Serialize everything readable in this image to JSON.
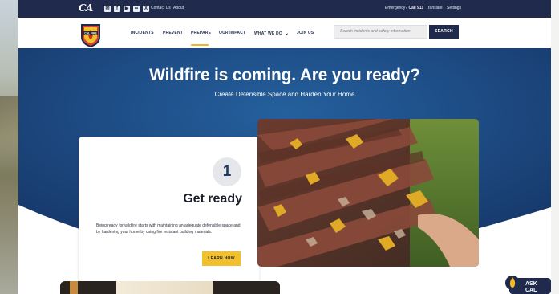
{
  "colors": {
    "navy": "#1f2a4c",
    "hero_blue": "#1e4f85",
    "accent_yellow": "#f2c02b",
    "active_underline": "#f2b824"
  },
  "utility_bar": {
    "logo": "CA",
    "social_icons": [
      "email-icon",
      "facebook-icon",
      "youtube-icon",
      "flickr-icon",
      "x-icon"
    ],
    "links": [
      "Contact Us",
      "About"
    ],
    "emergency_prefix": "Emergency?",
    "emergency_call": "Call 911",
    "translate": "Translate",
    "settings": "Settings"
  },
  "nav": {
    "logo_text": "CAL FIRE",
    "items": [
      {
        "label": "INCIDENTS"
      },
      {
        "label": "PREVENT"
      },
      {
        "label": "PREPARE",
        "active": true
      },
      {
        "label": "OUR IMPACT"
      },
      {
        "label": "WHAT WE DO"
      },
      {
        "label": "JOIN US"
      }
    ],
    "search_placeholder": "Search incidents and safety information",
    "search_button": "SEARCH"
  },
  "hero": {
    "title": "Wildfire is coming. Are you ready?",
    "subtitle": "Create Defensible Space and Harden Your Home"
  },
  "card": {
    "step": "1",
    "title": "Get ready",
    "body": "Being ready for wildfire starts with maintaining an adequate defensible space and by hardening your home by using fire resistant building materials.",
    "button": "LEARN HOW"
  },
  "ask_widget": {
    "line1": "ASK",
    "line2": "CAL FIRE"
  }
}
